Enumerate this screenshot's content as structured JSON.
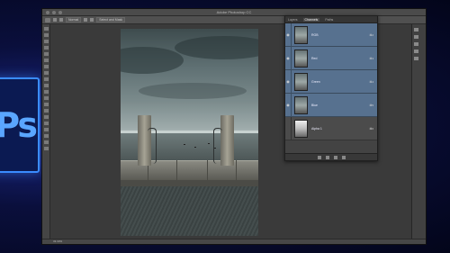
{
  "app": {
    "title": "Adobe Photoshop CC",
    "logo_text": "Ps"
  },
  "options_bar": {
    "mode_label": "Normal",
    "select_label": "Select and Mask"
  },
  "layers_panel": {
    "tabs": [
      "Layers",
      "Channels",
      "Paths"
    ],
    "active_tab": "Channels",
    "layers": [
      {
        "name": "RGB",
        "shortcut": "⌘2"
      },
      {
        "name": "Red",
        "shortcut": "⌘3"
      },
      {
        "name": "Green",
        "shortcut": "⌘4"
      },
      {
        "name": "Blue",
        "shortcut": "⌘5"
      },
      {
        "name": "Alpha 1",
        "shortcut": "⌘6"
      }
    ]
  },
  "status": {
    "zoom": "33.33%"
  },
  "colors": {
    "brand": "#3a8cff",
    "selected_layer": "#57718f"
  }
}
